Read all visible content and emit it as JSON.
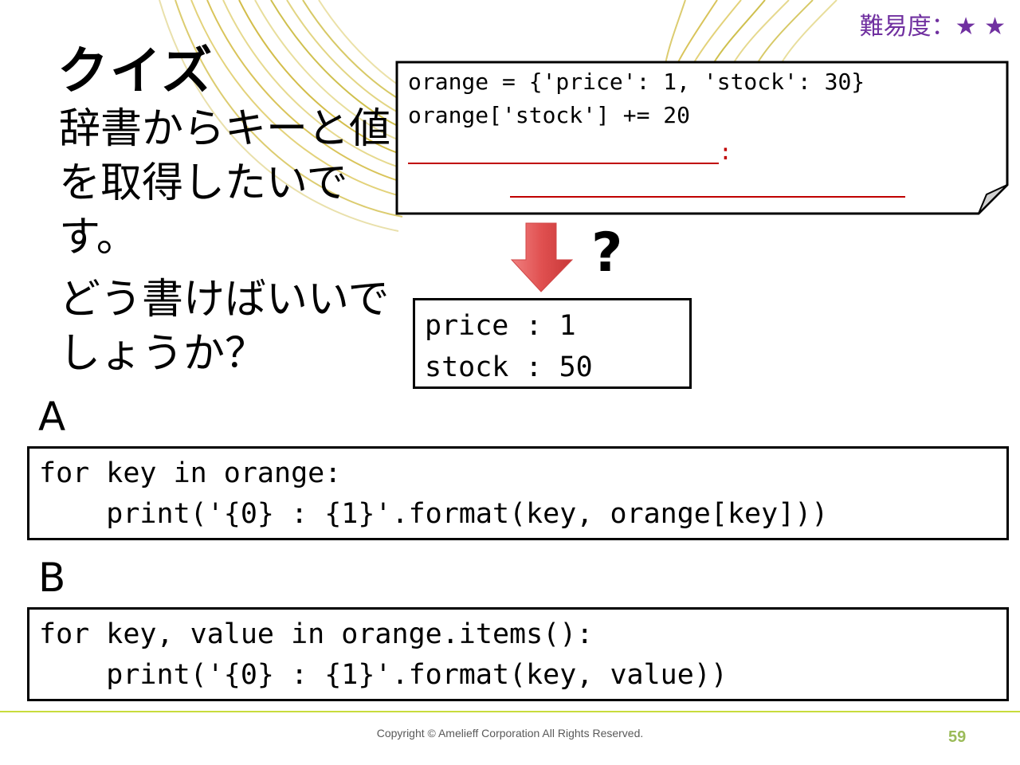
{
  "slide": {
    "difficulty": "難易度：★ ★",
    "title": "クイズ",
    "question": [
      "辞書からキーと値を取得したいです。",
      "どう書けばいいでしょうか？"
    ],
    "code": [
      "orange = {'price': 1, 'stock': 30}",
      "orange['stock'] += 20"
    ],
    "blank_colon": ":",
    "question_mark": "?",
    "output": "price : 1\nstock : 50",
    "options": [
      {
        "label": "A",
        "code": "for key in orange:\n    print('{0} : {1}'.format(key, orange[key]))"
      },
      {
        "label": "B",
        "code": "for key, value in orange.items():\n    print('{0} : {1}'.format(key, value))"
      }
    ]
  },
  "footer": {
    "copyright": "Copyright © Amelieff Corporation All Rights Reserved.",
    "page_number": "59"
  },
  "colors": {
    "difficulty": "#7030a0",
    "blank": "#c00000",
    "arrow": "#e05050",
    "footer_line": "#c8dc3c",
    "page_number": "#9bbb59"
  }
}
